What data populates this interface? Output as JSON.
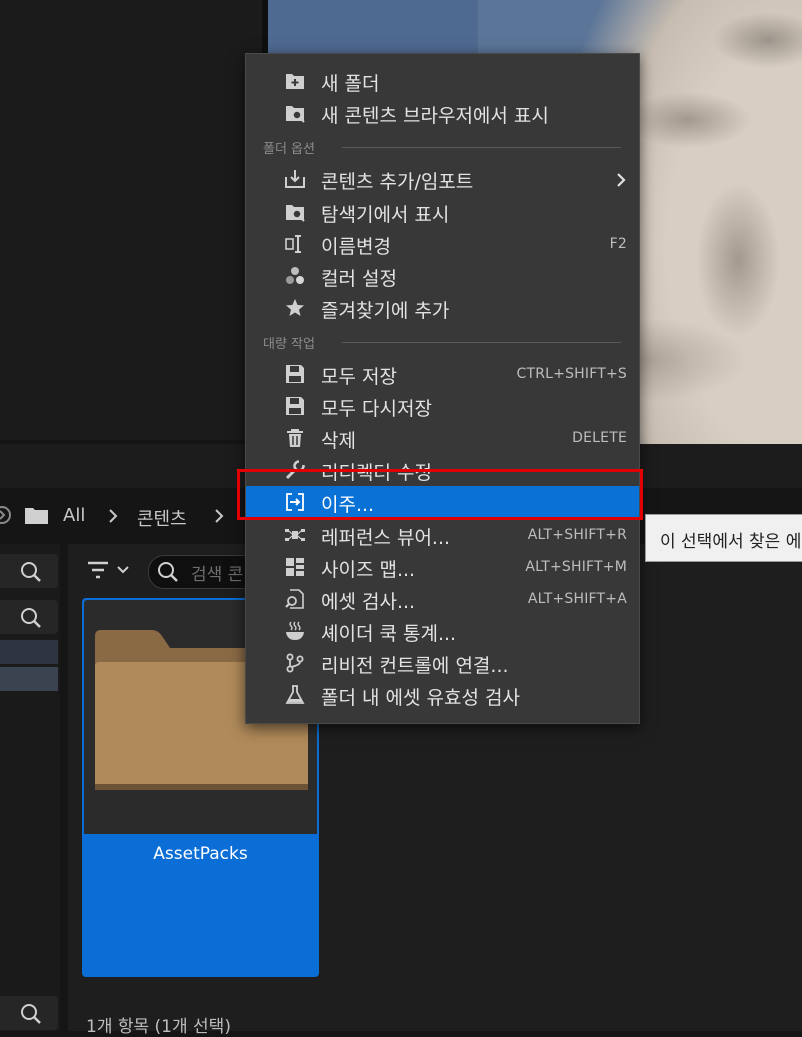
{
  "path": {
    "root": "All",
    "folder": "콘텐츠"
  },
  "filter": {
    "search_placeholder": "검색 콘"
  },
  "tile": {
    "label": "AssetPacks"
  },
  "status": {
    "text": "1개 항목 (1개 선택)"
  },
  "menu": {
    "top_items": [
      {
        "label": "새 폴더",
        "icon": "new-folder-icon"
      },
      {
        "label": "새 콘텐츠 브라우저에서 표시",
        "icon": "folder-search-icon"
      }
    ],
    "section_folder": "폴더 옵션",
    "folder_items": [
      {
        "label": "콘텐츠 추가/임포트",
        "icon": "import-icon",
        "submenu": true
      },
      {
        "label": "탐색기에서 표시",
        "icon": "folder-search-icon"
      },
      {
        "label": "이름변경",
        "icon": "rename-icon",
        "shortcut": "F2"
      },
      {
        "label": "컬러 설정",
        "icon": "color-icon"
      },
      {
        "label": "즐겨찾기에 추가",
        "icon": "star-icon"
      }
    ],
    "section_bulk": "대량 작업",
    "bulk_items": [
      {
        "label": "모두 저장",
        "icon": "save-icon",
        "shortcut": "CTRL+SHIFT+S"
      },
      {
        "label": "모두 다시저장",
        "icon": "save-icon"
      },
      {
        "label": "삭제",
        "icon": "trash-icon",
        "shortcut": "DELETE"
      },
      {
        "label": "리디렉터 수정",
        "icon": "wrench-icon"
      },
      {
        "label": "이주...",
        "icon": "migrate-icon",
        "selected": true
      },
      {
        "label": "레퍼런스 뷰어...",
        "icon": "reference-viewer-icon",
        "shortcut": "ALT+SHIFT+R"
      },
      {
        "label": "사이즈 맵...",
        "icon": "size-map-icon",
        "shortcut": "ALT+SHIFT+M"
      },
      {
        "label": "에셋 검사...",
        "icon": "audit-icon",
        "shortcut": "ALT+SHIFT+A"
      },
      {
        "label": "셰이더 쿡 통계...",
        "icon": "shader-cook-icon"
      },
      {
        "label": "리비전 컨트롤에 연결...",
        "icon": "source-control-icon"
      },
      {
        "label": "폴더 내 에셋 유효성 검사",
        "icon": "validate-flask-icon"
      }
    ]
  },
  "tooltip": {
    "text": "이 선택에서 찾은 에"
  },
  "colors": {
    "selection": "#0a72d6",
    "highlight_box": "#e00000",
    "menu_bg": "#383838"
  }
}
